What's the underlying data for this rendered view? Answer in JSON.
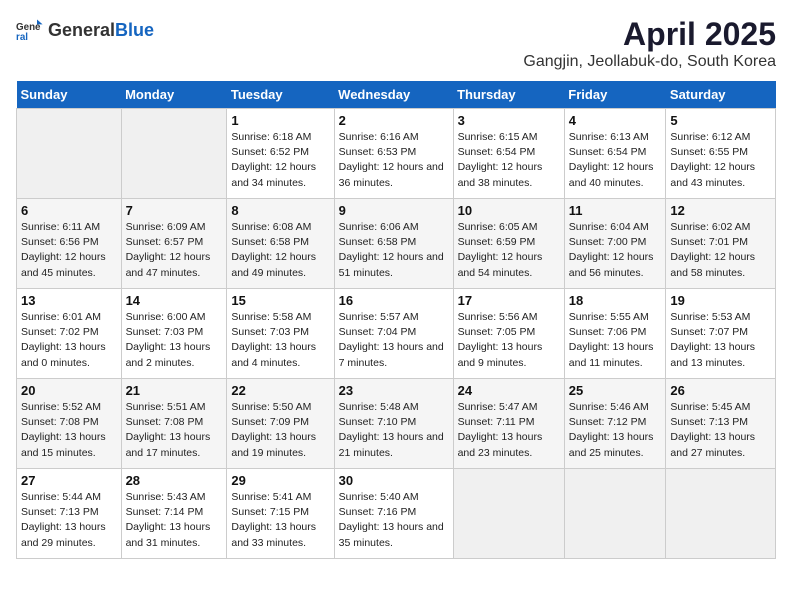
{
  "header": {
    "logo_general": "General",
    "logo_blue": "Blue",
    "title": "April 2025",
    "subtitle": "Gangjin, Jeollabuk-do, South Korea"
  },
  "days_of_week": [
    "Sunday",
    "Monday",
    "Tuesday",
    "Wednesday",
    "Thursday",
    "Friday",
    "Saturday"
  ],
  "weeks": [
    [
      {
        "day": "",
        "info": ""
      },
      {
        "day": "",
        "info": ""
      },
      {
        "day": "1",
        "info": "Sunrise: 6:18 AM\nSunset: 6:52 PM\nDaylight: 12 hours and 34 minutes."
      },
      {
        "day": "2",
        "info": "Sunrise: 6:16 AM\nSunset: 6:53 PM\nDaylight: 12 hours and 36 minutes."
      },
      {
        "day": "3",
        "info": "Sunrise: 6:15 AM\nSunset: 6:54 PM\nDaylight: 12 hours and 38 minutes."
      },
      {
        "day": "4",
        "info": "Sunrise: 6:13 AM\nSunset: 6:54 PM\nDaylight: 12 hours and 40 minutes."
      },
      {
        "day": "5",
        "info": "Sunrise: 6:12 AM\nSunset: 6:55 PM\nDaylight: 12 hours and 43 minutes."
      }
    ],
    [
      {
        "day": "6",
        "info": "Sunrise: 6:11 AM\nSunset: 6:56 PM\nDaylight: 12 hours and 45 minutes."
      },
      {
        "day": "7",
        "info": "Sunrise: 6:09 AM\nSunset: 6:57 PM\nDaylight: 12 hours and 47 minutes."
      },
      {
        "day": "8",
        "info": "Sunrise: 6:08 AM\nSunset: 6:58 PM\nDaylight: 12 hours and 49 minutes."
      },
      {
        "day": "9",
        "info": "Sunrise: 6:06 AM\nSunset: 6:58 PM\nDaylight: 12 hours and 51 minutes."
      },
      {
        "day": "10",
        "info": "Sunrise: 6:05 AM\nSunset: 6:59 PM\nDaylight: 12 hours and 54 minutes."
      },
      {
        "day": "11",
        "info": "Sunrise: 6:04 AM\nSunset: 7:00 PM\nDaylight: 12 hours and 56 minutes."
      },
      {
        "day": "12",
        "info": "Sunrise: 6:02 AM\nSunset: 7:01 PM\nDaylight: 12 hours and 58 minutes."
      }
    ],
    [
      {
        "day": "13",
        "info": "Sunrise: 6:01 AM\nSunset: 7:02 PM\nDaylight: 13 hours and 0 minutes."
      },
      {
        "day": "14",
        "info": "Sunrise: 6:00 AM\nSunset: 7:03 PM\nDaylight: 13 hours and 2 minutes."
      },
      {
        "day": "15",
        "info": "Sunrise: 5:58 AM\nSunset: 7:03 PM\nDaylight: 13 hours and 4 minutes."
      },
      {
        "day": "16",
        "info": "Sunrise: 5:57 AM\nSunset: 7:04 PM\nDaylight: 13 hours and 7 minutes."
      },
      {
        "day": "17",
        "info": "Sunrise: 5:56 AM\nSunset: 7:05 PM\nDaylight: 13 hours and 9 minutes."
      },
      {
        "day": "18",
        "info": "Sunrise: 5:55 AM\nSunset: 7:06 PM\nDaylight: 13 hours and 11 minutes."
      },
      {
        "day": "19",
        "info": "Sunrise: 5:53 AM\nSunset: 7:07 PM\nDaylight: 13 hours and 13 minutes."
      }
    ],
    [
      {
        "day": "20",
        "info": "Sunrise: 5:52 AM\nSunset: 7:08 PM\nDaylight: 13 hours and 15 minutes."
      },
      {
        "day": "21",
        "info": "Sunrise: 5:51 AM\nSunset: 7:08 PM\nDaylight: 13 hours and 17 minutes."
      },
      {
        "day": "22",
        "info": "Sunrise: 5:50 AM\nSunset: 7:09 PM\nDaylight: 13 hours and 19 minutes."
      },
      {
        "day": "23",
        "info": "Sunrise: 5:48 AM\nSunset: 7:10 PM\nDaylight: 13 hours and 21 minutes."
      },
      {
        "day": "24",
        "info": "Sunrise: 5:47 AM\nSunset: 7:11 PM\nDaylight: 13 hours and 23 minutes."
      },
      {
        "day": "25",
        "info": "Sunrise: 5:46 AM\nSunset: 7:12 PM\nDaylight: 13 hours and 25 minutes."
      },
      {
        "day": "26",
        "info": "Sunrise: 5:45 AM\nSunset: 7:13 PM\nDaylight: 13 hours and 27 minutes."
      }
    ],
    [
      {
        "day": "27",
        "info": "Sunrise: 5:44 AM\nSunset: 7:13 PM\nDaylight: 13 hours and 29 minutes."
      },
      {
        "day": "28",
        "info": "Sunrise: 5:43 AM\nSunset: 7:14 PM\nDaylight: 13 hours and 31 minutes."
      },
      {
        "day": "29",
        "info": "Sunrise: 5:41 AM\nSunset: 7:15 PM\nDaylight: 13 hours and 33 minutes."
      },
      {
        "day": "30",
        "info": "Sunrise: 5:40 AM\nSunset: 7:16 PM\nDaylight: 13 hours and 35 minutes."
      },
      {
        "day": "",
        "info": ""
      },
      {
        "day": "",
        "info": ""
      },
      {
        "day": "",
        "info": ""
      }
    ]
  ]
}
